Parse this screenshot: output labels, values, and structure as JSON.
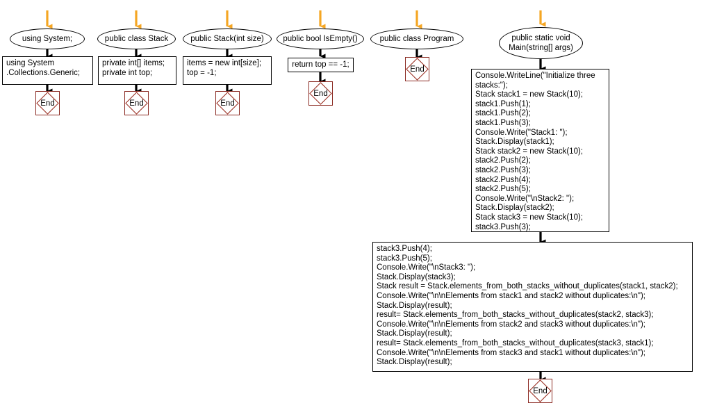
{
  "diagram": {
    "type": "flowchart",
    "title": "C# Stack program flowchart",
    "colors": {
      "node_border": "#000000",
      "end_border": "#8b2a22",
      "end_diamond": "#a13c30",
      "entry_arrow": "#f5a623",
      "connector": "#000000",
      "background": "#ffffff"
    },
    "end_label": "End"
  },
  "columns": [
    {
      "id": "using-system",
      "header": "using System;",
      "body": "using System\n.Collections.Generic;",
      "end": "End"
    },
    {
      "id": "public-class-stack",
      "header": "public class Stack",
      "body": "private int[] items;\nprivate int top;",
      "end": "End"
    },
    {
      "id": "public-stack-ctor",
      "header": "public Stack(int size)",
      "body": "items = new int[size];\ntop = -1;",
      "end": "End"
    },
    {
      "id": "public-bool-isempty",
      "header": "public bool IsEmpty()",
      "body": "return top == -1;",
      "end": "End"
    },
    {
      "id": "public-class-program",
      "header": "public class Program",
      "body": null,
      "end": "End"
    },
    {
      "id": "main-method",
      "header": "public static void Main(string[] args)",
      "header_line1": "public static void",
      "header_line2": "Main(string[] args)",
      "body": null,
      "end": null
    }
  ],
  "main_block_top": {
    "id": "main-code-block-1",
    "lines": [
      "Console.WriteLine(\"Initialize three",
      "stacks:\");",
      "Stack stack1 = new Stack(10);",
      "stack1.Push(1);",
      "stack1.Push(2);",
      "stack1.Push(3);",
      "Console.Write(\"Stack1: \");",
      "Stack.Display(stack1);",
      "Stack stack2 = new Stack(10);",
      "stack2.Push(2);",
      "stack2.Push(3);",
      "stack2.Push(4);",
      "stack2.Push(5);",
      "Console.Write(\"\\nStack2: \");",
      "Stack.Display(stack2);",
      "Stack stack3 = new Stack(10);",
      "stack3.Push(3);"
    ]
  },
  "main_block_bottom": {
    "id": "main-code-block-2",
    "lines": [
      "stack3.Push(4);",
      "stack3.Push(5);",
      "Console.Write(\"\\nStack3: \");",
      "Stack.Display(stack3);",
      "Stack result = Stack.elements_from_both_stacks_without_duplicates(stack1, stack2);",
      "Console.Write(\"\\n\\nElements from stack1 and stack2 without duplicates:\\n\");",
      "Stack.Display(result);",
      "result= Stack.elements_from_both_stacks_without_duplicates(stack2, stack3);",
      "Console.Write(\"\\n\\nElements from stack2 and stack3 without duplicates:\\n\");",
      "Stack.Display(result);",
      "result= Stack.elements_from_both_stacks_without_duplicates(stack3, stack1);",
      "Console.Write(\"\\n\\nElements from stack3 and stack1 without duplicates:\\n\");",
      "Stack.Display(result);"
    ]
  },
  "final_end": {
    "id": "final-end-node",
    "label": "End"
  }
}
